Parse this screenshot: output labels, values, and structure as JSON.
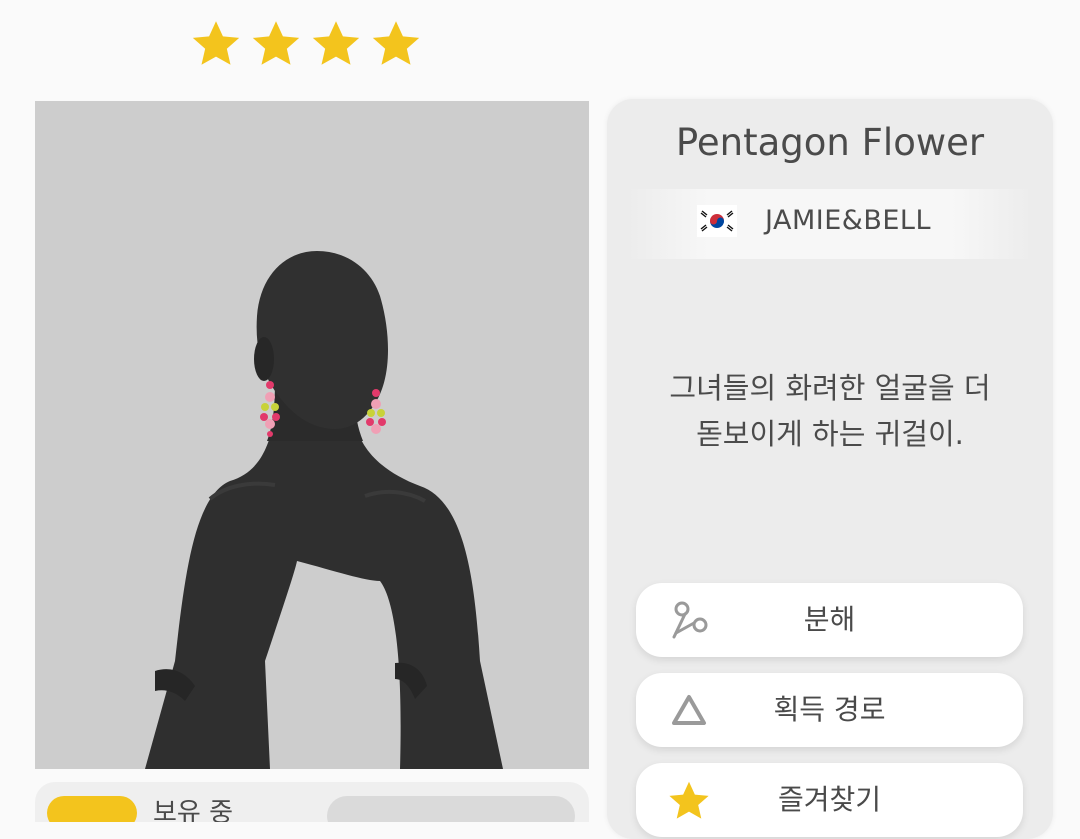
{
  "rating": {
    "stars": 4,
    "star_color": "#f3c41d"
  },
  "item": {
    "name": "Pentagon Flower",
    "brand": "JAMIE&BELL",
    "brand_country_flag": "korea-flag-icon",
    "description_line1": "그녀들의 화려한 얼굴을 더",
    "description_line2": "돋보이게 하는 귀걸이."
  },
  "actions": {
    "disassemble": {
      "label": "분해",
      "icon": "scissors-icon"
    },
    "acquire_path": {
      "label": "획득 경로",
      "icon": "triangle-outline-icon"
    },
    "favorite": {
      "label": "즐겨찾기",
      "icon": "star-icon"
    }
  },
  "preview": {
    "background": "#cdcdcd",
    "mannequin_color": "#2f2f2f",
    "earring_colors": [
      "#e23a6b",
      "#f0a0b5",
      "#c8d23a"
    ]
  },
  "inventory": {
    "owned_label": "보유 중"
  },
  "colors": {
    "panel_bg": "#ececec",
    "text": "#4b4b4b",
    "accent": "#f3c41d"
  }
}
